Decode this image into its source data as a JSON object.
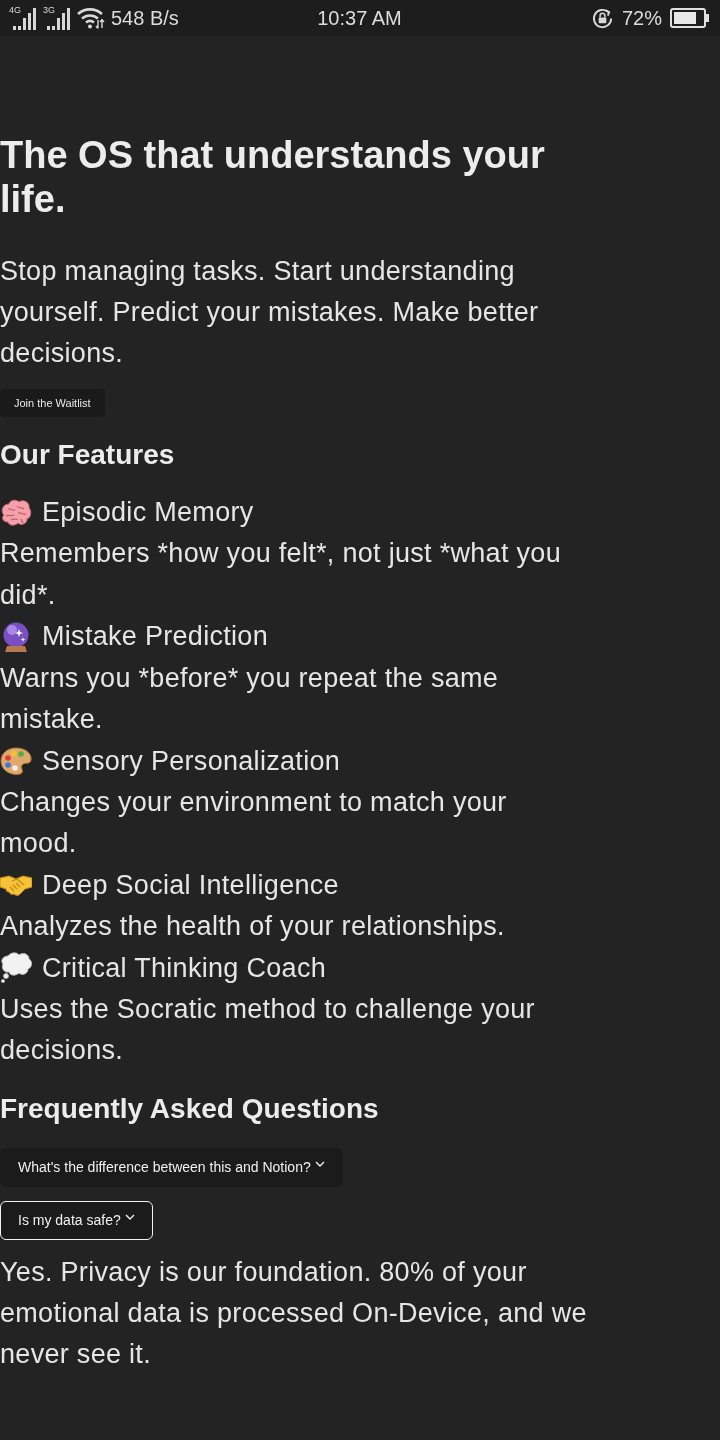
{
  "status_bar": {
    "network_labels": [
      "4G",
      "3G"
    ],
    "data_speed": "548 B/s",
    "time": "10:37 AM",
    "battery_percent": "72%"
  },
  "hero": {
    "title": "The OS that understands your life.",
    "subtitle": "Stop managing tasks. Start understanding yourself. Predict your mistakes. Make better decisions.",
    "button": "Join the Waitlist"
  },
  "features": {
    "heading": "Our Features",
    "items": [
      {
        "title": "Episodic Memory",
        "description": "Remembers *how you felt*, not just *what you did*."
      },
      {
        "title": "Mistake Prediction",
        "description": "Warns you *before* you repeat the same mistake."
      },
      {
        "title": "Sensory Personalization",
        "description": "Changes your environment to match your mood."
      },
      {
        "title": "Deep Social Intelligence",
        "description": "Analyzes the health of your relationships."
      },
      {
        "title": "Critical Thinking Coach",
        "description": "Uses the Socratic method to challenge your decisions."
      }
    ]
  },
  "faq": {
    "heading": "Frequently Asked Questions",
    "items": [
      {
        "question": "What's the difference between this and Notion?",
        "expanded": false
      },
      {
        "question": "Is my data safe?",
        "expanded": true,
        "answer": "Yes. Privacy is our foundation. 80% of your emotional data is processed On-Device, and we never see it."
      }
    ]
  }
}
